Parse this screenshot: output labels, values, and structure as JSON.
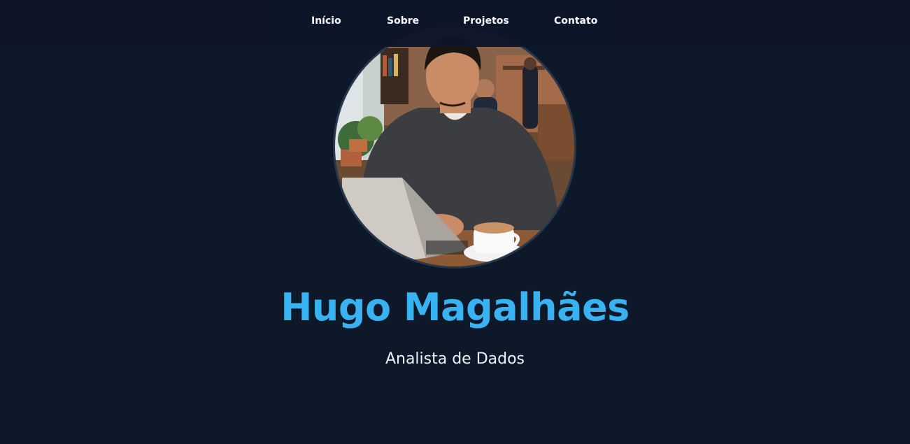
{
  "nav": {
    "items": [
      {
        "label": "Início"
      },
      {
        "label": "Sobre"
      },
      {
        "label": "Projetos"
      },
      {
        "label": "Contato"
      }
    ]
  },
  "hero": {
    "name": "Hugo Magalhães",
    "role": "Analista de Dados",
    "avatar_alt": "Foto de perfil"
  },
  "colors": {
    "background": "#0d1829",
    "navbar": "#0e1628",
    "accent": "#38b2f0",
    "text": "#eef2f7"
  }
}
